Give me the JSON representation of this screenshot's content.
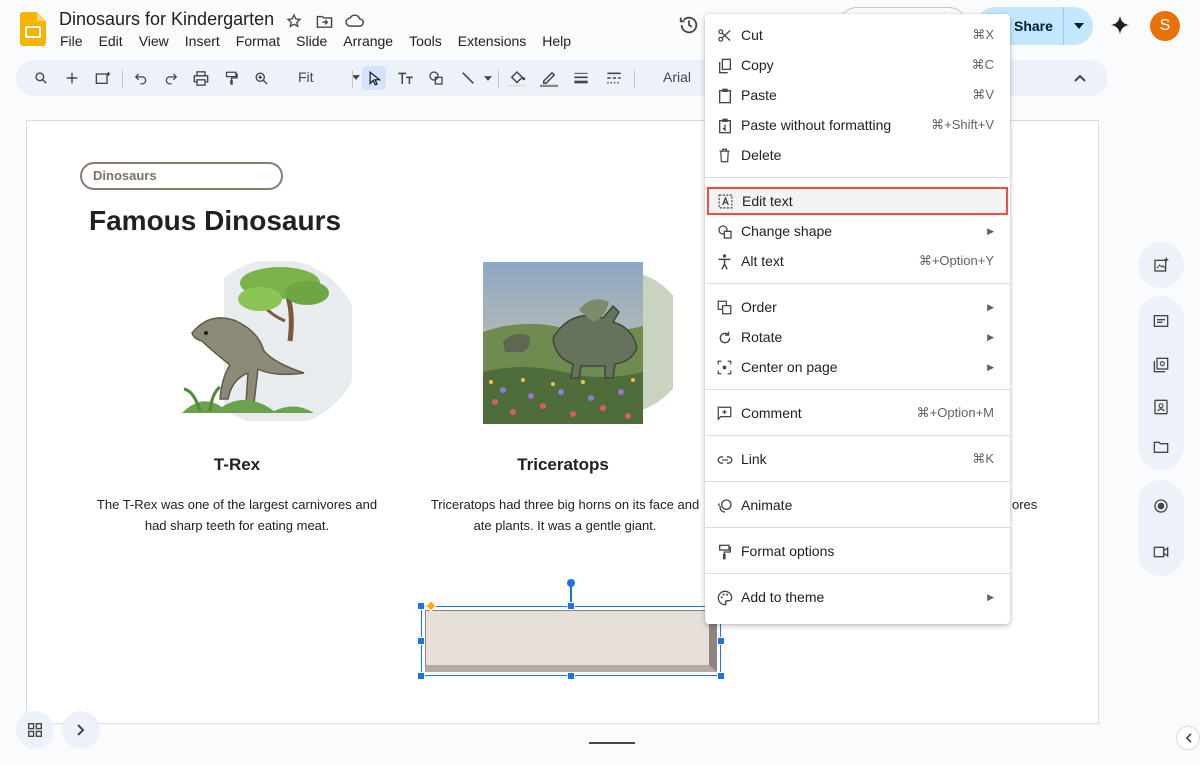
{
  "app": {
    "doc_title": "Dinosaurs for Kindergarten",
    "menus": [
      "File",
      "Edit",
      "View",
      "Insert",
      "Format",
      "Slide",
      "Arrange",
      "Tools",
      "Extensions",
      "Help"
    ],
    "share_label": "Share",
    "avatar_letter": "S",
    "brand_color": "#f4b400"
  },
  "toolbar": {
    "zoom": "Fit",
    "font": "Arial"
  },
  "slide": {
    "tag": "Dinosaurs",
    "title": "Famous Dinosaurs",
    "columns": [
      {
        "heading": "T-Rex",
        "desc_line1": "The T-Rex was one of the largest carnivores and",
        "desc_line2": "had sharp teeth for eating meat."
      },
      {
        "heading": "Triceratops",
        "desc_line1": "Triceratops had three big horns on its face and",
        "desc_line2": "ate plants. It was a gentle giant."
      }
    ],
    "right_text_fragment": "ores"
  },
  "context_menu": {
    "cut": {
      "label": "Cut",
      "shortcut": "⌘X"
    },
    "copy": {
      "label": "Copy",
      "shortcut": "⌘C"
    },
    "paste": {
      "label": "Paste",
      "shortcut": "⌘V"
    },
    "paste_plain": {
      "label": "Paste without formatting",
      "shortcut": "⌘+Shift+V"
    },
    "delete": {
      "label": "Delete"
    },
    "edit_text": {
      "label": "Edit text"
    },
    "change_shape": {
      "label": "Change shape"
    },
    "alt_text": {
      "label": "Alt text",
      "shortcut": "⌘+Option+Y"
    },
    "order": {
      "label": "Order"
    },
    "rotate": {
      "label": "Rotate"
    },
    "center": {
      "label": "Center on page"
    },
    "comment": {
      "label": "Comment",
      "shortcut": "⌘+Option+M"
    },
    "link": {
      "label": "Link",
      "shortcut": "⌘K"
    },
    "animate": {
      "label": "Animate"
    },
    "format_options": {
      "label": "Format options"
    },
    "add_to_theme": {
      "label": "Add to theme"
    }
  }
}
